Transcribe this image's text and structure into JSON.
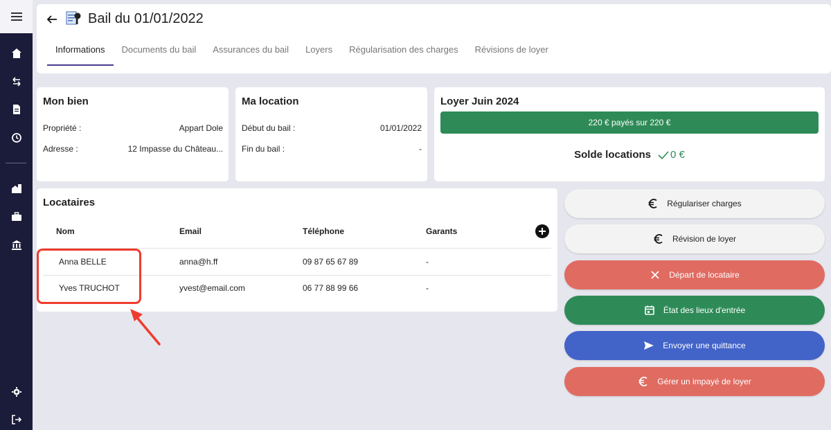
{
  "header": {
    "title": "Bail du 01/01/2022",
    "tabs": [
      {
        "label": "Informations"
      },
      {
        "label": "Documents du bail"
      },
      {
        "label": "Assurances du bail"
      },
      {
        "label": "Loyers"
      },
      {
        "label": "Régularisation des charges"
      },
      {
        "label": "Révisions de loyer"
      }
    ]
  },
  "mon_bien": {
    "title": "Mon bien",
    "rows": [
      {
        "label": "Propriété :",
        "value": "Appart Dole"
      },
      {
        "label": "Adresse :",
        "value": "12 Impasse du Château..."
      }
    ]
  },
  "ma_location": {
    "title": "Ma location",
    "rows": [
      {
        "label": "Début du bail :",
        "value": "01/01/2022"
      },
      {
        "label": "Fin du bail :",
        "value": "-"
      }
    ]
  },
  "loyer": {
    "title": "Loyer Juin 2024",
    "paid_text": "220 € payés sur 220 €",
    "solde_label": "Solde locations",
    "solde_value": "0 €"
  },
  "locataires": {
    "title": "Locataires",
    "columns": [
      "Nom",
      "Email",
      "Téléphone",
      "Garants"
    ],
    "rows": [
      {
        "nom": "Anna BELLE",
        "email": "anna@h.ff",
        "telephone": "09 87 65 67 89",
        "garants": "-"
      },
      {
        "nom": "Yves TRUCHOT",
        "email": "yvest@email.com",
        "telephone": "06 77 88 99 66",
        "garants": "-"
      }
    ]
  },
  "actions": [
    {
      "label": "Régulariser charges",
      "icon": "euro-icon"
    },
    {
      "label": "Révision de loyer",
      "icon": "euro-icon"
    },
    {
      "label": "Départ de locataire",
      "icon": "close-icon"
    },
    {
      "label": "État des lieux d'entrée",
      "icon": "calendar-icon"
    },
    {
      "label": "Envoyer une quittance",
      "icon": "send-icon"
    },
    {
      "label": "Gérer un impayé de loyer",
      "icon": "euro-icon"
    }
  ],
  "colors": {
    "sidebar": "#1b1b3a",
    "accent": "#4b3b8f",
    "green": "#2e8b57",
    "red": "#e06b61",
    "blue": "#4263c8",
    "highlight": "#ef3b2d"
  }
}
